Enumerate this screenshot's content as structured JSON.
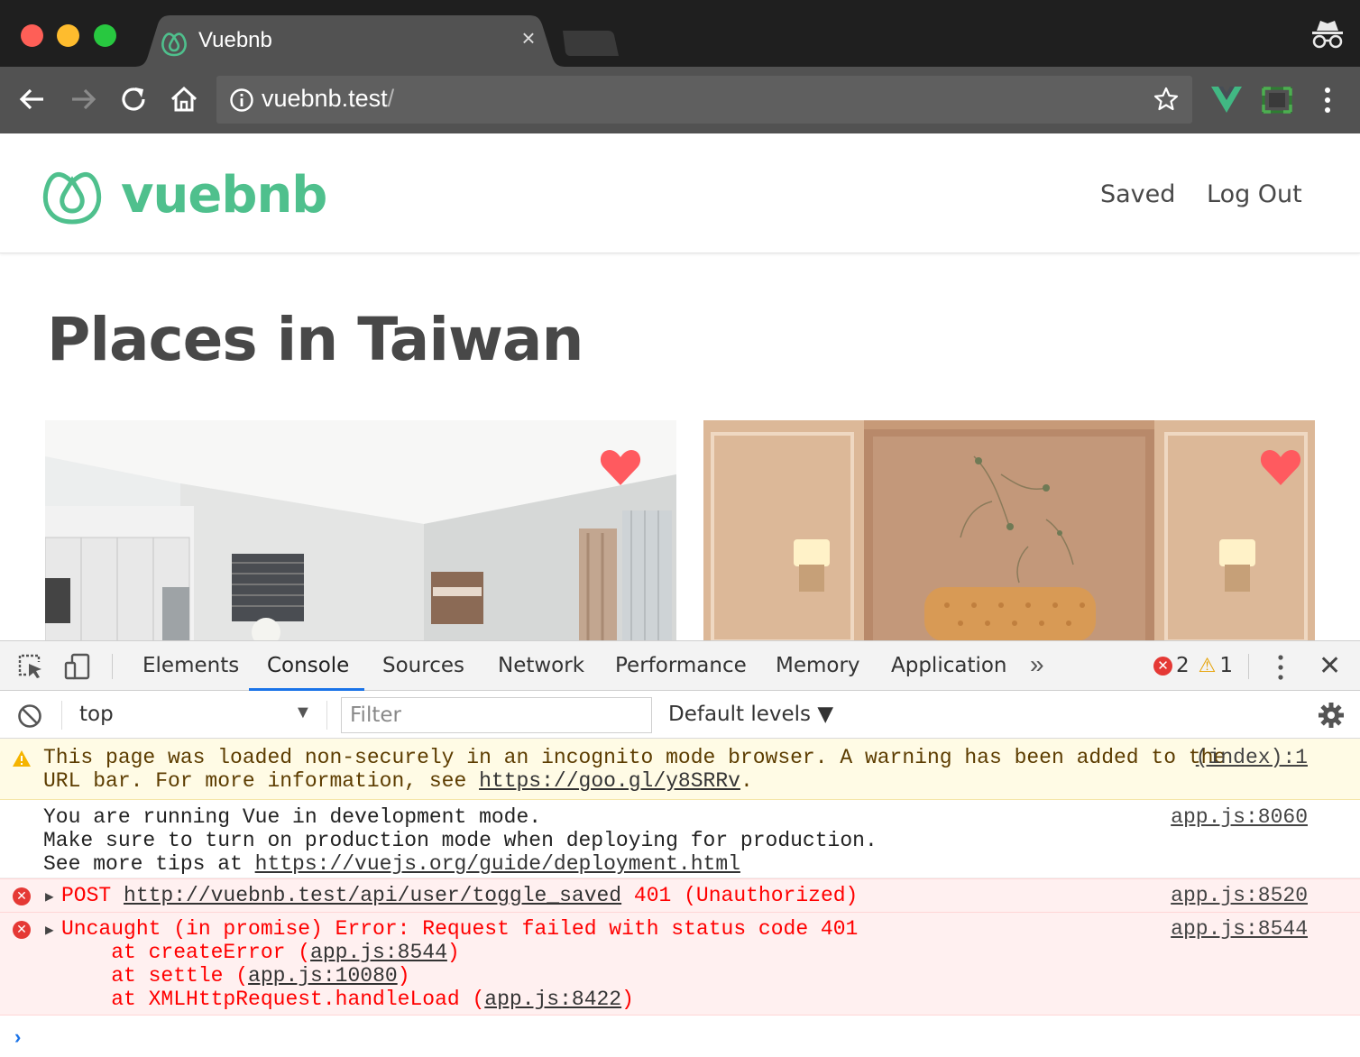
{
  "window": {
    "tab_title": "Vuebnb",
    "tab_close": "×",
    "url_host": "vuebnb.test",
    "url_path": "/"
  },
  "site": {
    "brand": "vuebnb",
    "nav": {
      "saved": "Saved",
      "logout": "Log Out"
    },
    "heading": "Places in Taiwan",
    "accent_color": "#4fc08d",
    "heart_color": "#ff5a5f"
  },
  "devtools": {
    "tabs": [
      "Elements",
      "Console",
      "Sources",
      "Network",
      "Performance",
      "Memory",
      "Application"
    ],
    "active_tab": "Console",
    "more": "»",
    "error_count": "2",
    "warning_count": "1",
    "close": "✕",
    "context": "top",
    "filter_placeholder": "Filter",
    "levels": "Default levels ▼"
  },
  "console": {
    "warning": {
      "line1": "This page was loaded non-securely in an incognito mode browser. A warning has been added to the",
      "line2_prefix": "URL bar. For more information, see ",
      "line2_link": "https://goo.gl/y8SRRv",
      "line2_suffix": ".",
      "source": "(index):1"
    },
    "log": {
      "line1": "You are running Vue in development mode.",
      "line2": "Make sure to turn on production mode when deploying for production.",
      "line3_prefix": "See more tips at ",
      "line3_link": "https://vuejs.org/guide/deployment.html",
      "source": "app.js:8060"
    },
    "error1": {
      "method": "POST ",
      "url": "http://vuebnb.test/api/user/toggle_saved",
      "status": " 401 (Unauthorized)",
      "source": "app.js:8520"
    },
    "error2": {
      "message": "Uncaught (in promise) Error: Request failed with status code 401",
      "stack": [
        {
          "prefix": "    at createError (",
          "link": "app.js:8544",
          "suffix": ")"
        },
        {
          "prefix": "    at settle (",
          "link": "app.js:10080",
          "suffix": ")"
        },
        {
          "prefix": "    at XMLHttpRequest.handleLoad (",
          "link": "app.js:8422",
          "suffix": ")"
        }
      ],
      "source": "app.js:8544"
    },
    "prompt": "›"
  }
}
